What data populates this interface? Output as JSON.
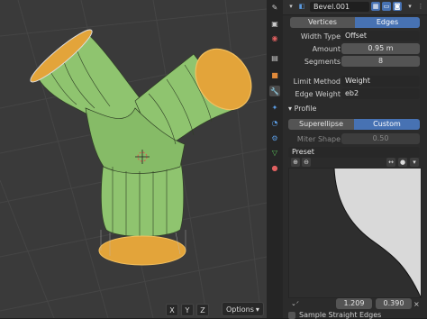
{
  "header": {
    "object_name": "Bevel.001"
  },
  "affect": {
    "vertices_label": "Vertices",
    "edges_label": "Edges"
  },
  "width_type": {
    "label": "Width Type",
    "value": "Offset"
  },
  "amount": {
    "label": "Amount",
    "value": "0.95 m"
  },
  "segments": {
    "label": "Segments",
    "value": "8"
  },
  "limit_method": {
    "label": "Limit Method",
    "value": "Weight"
  },
  "edge_weight": {
    "label": "Edge Weight",
    "value": "eb2"
  },
  "profile": {
    "title": "Profile",
    "superellipse_label": "Superellipse",
    "custom_label": "Custom",
    "miter_label": "Miter Shape",
    "miter_value": "0.50"
  },
  "preset": {
    "label": "Preset"
  },
  "curve": {
    "x_value": "1.209",
    "y_value": "0.390"
  },
  "sample": {
    "label": "Sample Straight Edges"
  },
  "viewport": {
    "axes": [
      "X",
      "Y",
      "Z"
    ],
    "options_label": "Options"
  },
  "colors": {
    "mesh": "#8fc46f",
    "selected_face": "#e3a43a",
    "accent": "#4772b3"
  }
}
